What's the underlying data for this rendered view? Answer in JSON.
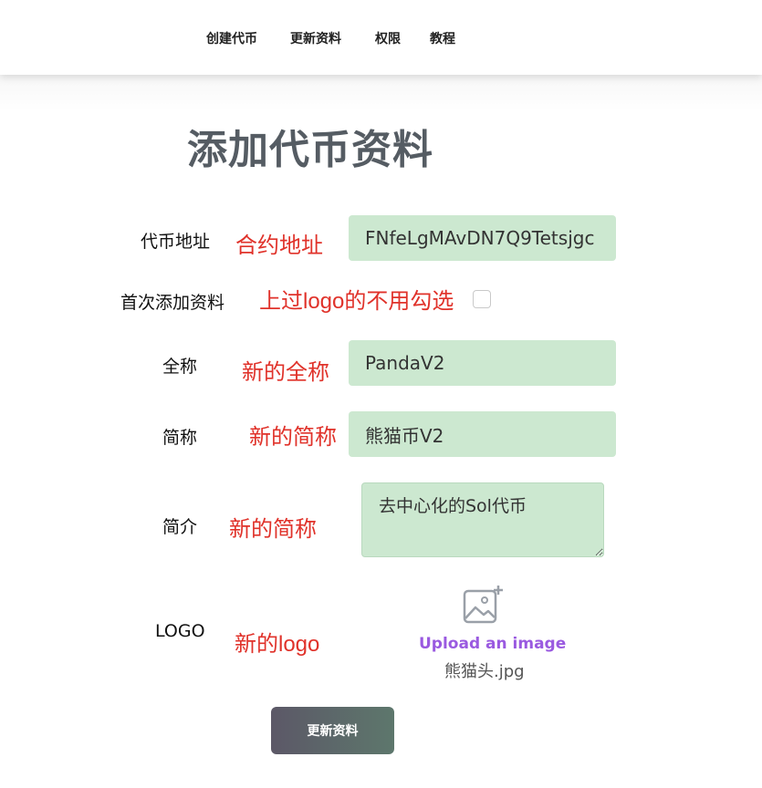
{
  "nav": {
    "items": [
      {
        "label": "创建代币"
      },
      {
        "label": "更新资料"
      },
      {
        "label": "权限"
      },
      {
        "label": "教程"
      }
    ]
  },
  "page": {
    "title": "添加代币资料"
  },
  "form": {
    "address": {
      "label": "代币地址",
      "note": "合约地址",
      "value": "FNfeLgMAvDN7Q9Tetsjgc"
    },
    "first_add": {
      "label": "首次添加资料",
      "note": "上过logo的不用勾选"
    },
    "full_name": {
      "label": "全称",
      "note": "新的全称",
      "value": "PandaV2"
    },
    "short_name": {
      "label": "简称",
      "note": "新的简称",
      "value": "熊猫币V2"
    },
    "intro": {
      "label": "简介",
      "note": "新的简称",
      "value": "去中心化的Sol代币"
    },
    "logo": {
      "label": "LOGO",
      "note": "新的logo",
      "upload_label": "Upload an image",
      "file_name": "熊猫头.jpg"
    },
    "submit_label": "更新资料"
  },
  "colors": {
    "note_red": "#e0322a",
    "input_bg": "#cce8d0",
    "upload_purple": "#9a5ae0",
    "button_gradient_start": "#5c5867",
    "button_gradient_end": "#5d776c"
  }
}
